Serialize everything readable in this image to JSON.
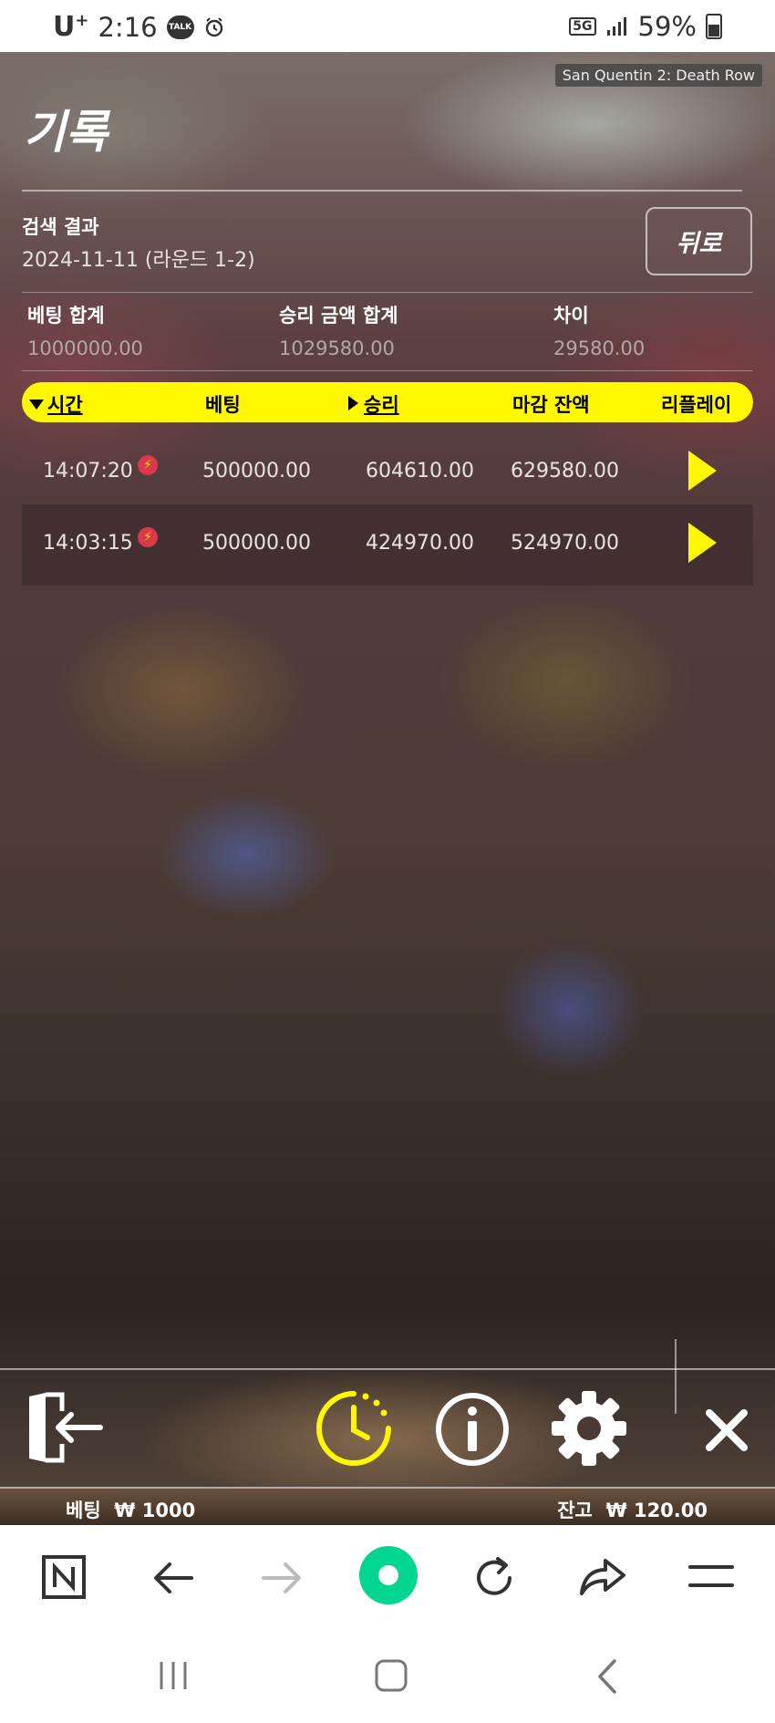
{
  "status_bar": {
    "carrier": "U",
    "carrier_sup": "+",
    "time": "2:16",
    "talk_badge": "TALK",
    "network": "5G",
    "battery": "59%"
  },
  "game": {
    "title": "San Quentin 2: Death Row"
  },
  "history": {
    "heading": "기록",
    "search_label": "검색 결과",
    "search_date": "2024-11-11 (라운드 1-2)",
    "back_label": "뒤로",
    "summary": {
      "bet_total_label": "베팅 합계",
      "bet_total": "1000000.00",
      "win_total_label": "승리 금액 합계",
      "win_total": "1029580.00",
      "diff_label": "차이",
      "diff": "29580.00"
    },
    "columns": {
      "time": "시간",
      "bet": "베팅",
      "win": "승리",
      "balance": "마감 잔액",
      "replay": "리플레이"
    },
    "rows": [
      {
        "time": "14:07:20",
        "bet": "500000.00",
        "win": "604610.00",
        "balance": "629580.00"
      },
      {
        "time": "14:03:15",
        "bet": "500000.00",
        "win": "424970.00",
        "balance": "524970.00"
      }
    ]
  },
  "footer": {
    "bet_label": "베팅",
    "bet_value": "₩ 1000",
    "balance_label": "잔고",
    "balance_value": "₩ 120.00"
  },
  "colors": {
    "accent_yellow": "#fff800",
    "bolt_red": "#d93a4a",
    "browser_green": "#00d68f"
  }
}
